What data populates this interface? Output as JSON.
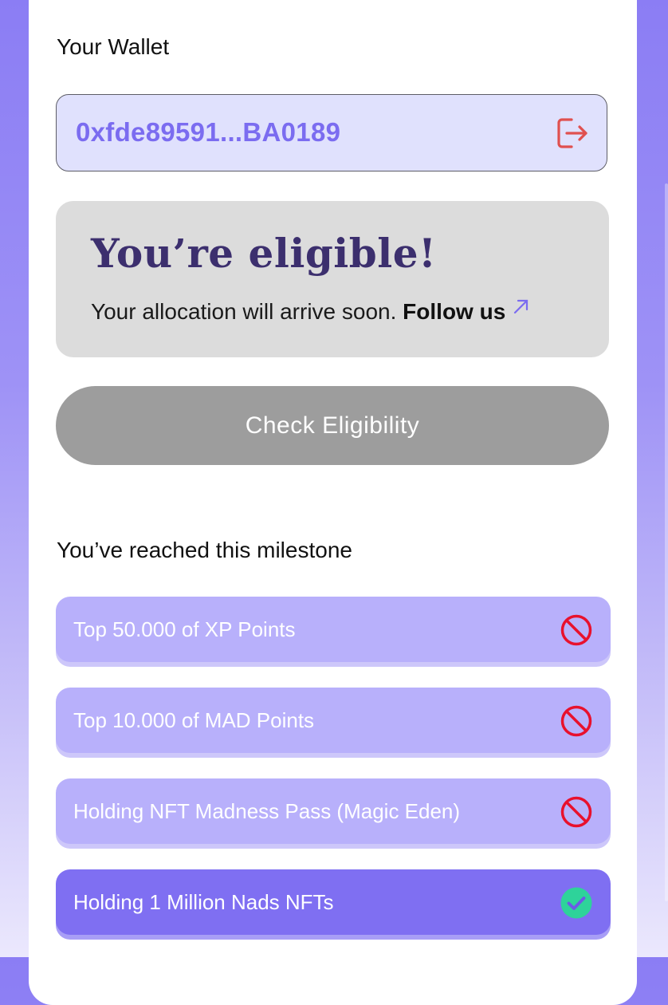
{
  "wallet": {
    "label": "Your Wallet",
    "address": "0xfde89591...BA0189"
  },
  "eligibility": {
    "title": "You’re eligible!",
    "subtitle": "Your allocation will arrive soon.",
    "follow_link": "Follow us"
  },
  "check_button": {
    "label": "Check Eligibility"
  },
  "milestones": {
    "heading": "You’ve reached this milestone",
    "items": [
      {
        "label": "Top 50.000 of XP Points",
        "status": "not-reached"
      },
      {
        "label": "Top 10.000 of MAD Points",
        "status": "not-reached"
      },
      {
        "label": "Holding NFT Madness Pass (Magic Eden)",
        "status": "not-reached"
      },
      {
        "label": "Holding 1 Million Nads NFTs",
        "status": "reached"
      }
    ]
  },
  "colors": {
    "accent": "#7b6cf0",
    "milestone_inactive": "#b8b0fb",
    "milestone_active": "#7f6ff2",
    "not_reached_icon": "#e8112d",
    "reached_icon": "#2ed39a",
    "logout_icon": "#e0504f"
  },
  "icons": {
    "logout": "logout-icon",
    "follow": "external-link-arrow-icon",
    "not_reached": "prohibited-icon",
    "reached": "check-circle-icon"
  }
}
